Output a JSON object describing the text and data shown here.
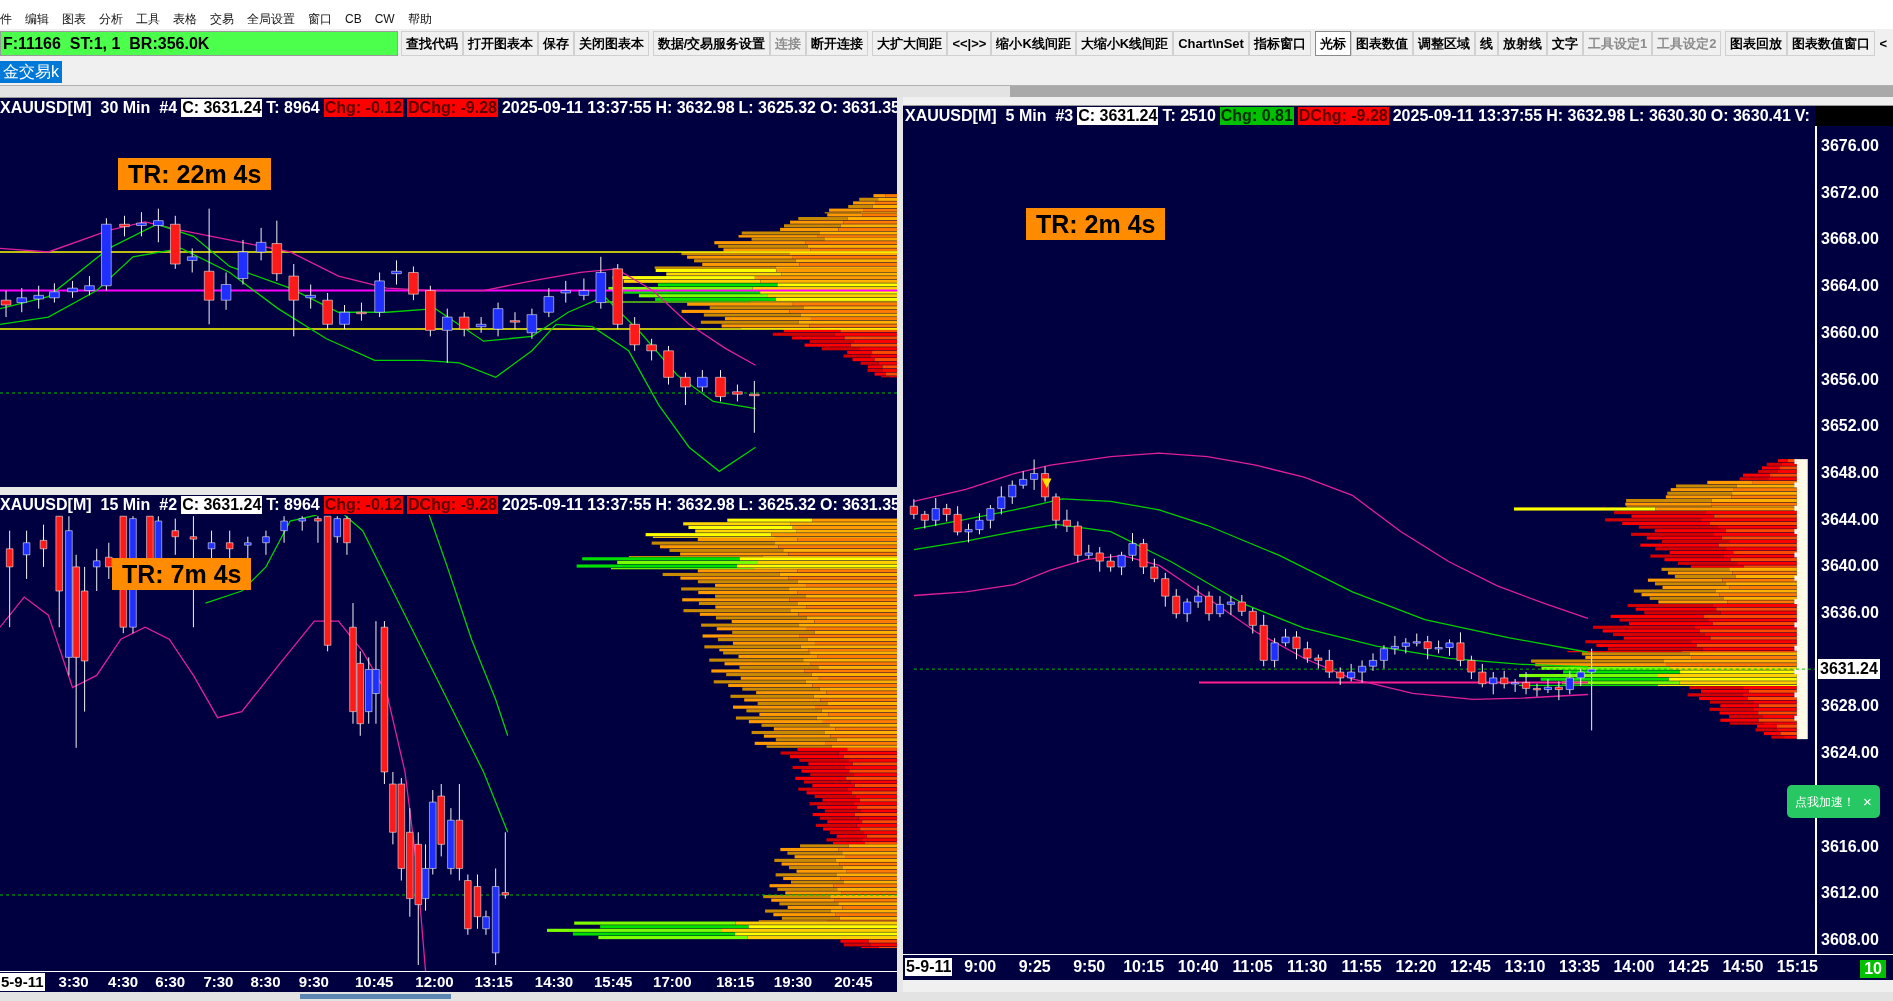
{
  "menu": [
    "件",
    "编辑",
    "图表",
    "分析",
    "工具",
    "表格",
    "交易",
    "全局设置",
    "窗口",
    "CB",
    "CW",
    "帮助"
  ],
  "toolbar": {
    "status": "F:11166  ST:1, 1  BR:356.0K",
    "button_groups": [
      [
        {
          "label": "查找代码",
          "disabled": false,
          "selected": false
        },
        {
          "label": "打开图表本",
          "disabled": false,
          "selected": false
        },
        {
          "label": "保存",
          "disabled": false,
          "selected": false
        },
        {
          "label": "关闭图表本",
          "disabled": false,
          "selected": false
        }
      ],
      [
        {
          "label": "数据/交易服务设置",
          "disabled": false,
          "selected": false
        },
        {
          "label": "连接",
          "disabled": true,
          "selected": false
        },
        {
          "label": "断开连接",
          "disabled": false,
          "selected": false
        }
      ],
      [
        {
          "label": "大扩大间距",
          "disabled": false,
          "selected": false
        },
        {
          "label": "<<|>>",
          "disabled": false,
          "selected": false
        },
        {
          "label": "缩小K线间距",
          "disabled": false,
          "selected": false
        },
        {
          "label": "大缩小K线间距",
          "disabled": false,
          "selected": false
        },
        {
          "label": "Chart\\nSet",
          "disabled": false,
          "selected": false
        },
        {
          "label": "指标窗口",
          "disabled": false,
          "selected": false
        }
      ],
      [
        {
          "label": "光标",
          "disabled": false,
          "selected": true
        },
        {
          "label": "图表数值",
          "disabled": false,
          "selected": false
        },
        {
          "label": "调整区域",
          "disabled": false,
          "selected": false
        },
        {
          "label": "线",
          "disabled": false,
          "selected": false
        },
        {
          "label": "放射线",
          "disabled": false,
          "selected": false
        },
        {
          "label": "文字",
          "disabled": false,
          "selected": false
        },
        {
          "label": "工具设定1",
          "disabled": true,
          "selected": false
        },
        {
          "label": "工具设定2",
          "disabled": true,
          "selected": false
        }
      ],
      [
        {
          "label": "图表回放",
          "disabled": false,
          "selected": false
        },
        {
          "label": "图表数值窗口",
          "disabled": false,
          "selected": false
        }
      ]
    ],
    "scroll_button": "<"
  },
  "tabs": [
    {
      "label": "金交易k",
      "selected": true
    }
  ],
  "left_charts": [
    {
      "header": {
        "symbol": "XAUUSD[M]",
        "interval": "30 Min",
        "chart_number": "#4",
        "close": "C: 3631.24",
        "trades": "T: 8964",
        "change": "Chg: -0.12",
        "change_positive": false,
        "daily_change": "DChg: -9.28",
        "daily_change_positive": false,
        "datetime": "2025-09-11 13:37:55",
        "high": "H: 3632.98",
        "low": "L: 3625.32",
        "open": "O: 3631.35"
      },
      "timer_label": "TR: 22m 4s"
    },
    {
      "header": {
        "symbol": "XAUUSD[M]",
        "interval": "15 Min",
        "chart_number": "#2",
        "close": "C: 3631.24",
        "trades": "T: 8964",
        "change": "Chg: -0.12",
        "change_positive": false,
        "daily_change": "DChg: -9.28",
        "daily_change_positive": false,
        "datetime": "2025-09-11 13:37:55",
        "high": "H: 3632.98",
        "low": "L: 3625.32",
        "open": "O: 3631.35"
      },
      "timer_label": "TR: 7m 4s",
      "x_axis_labels": [
        {
          "text": "5-9-11",
          "kind": "date"
        },
        {
          "text": "3:30",
          "kind": "time"
        },
        {
          "text": "4:30",
          "kind": "time"
        },
        {
          "text": "6:30",
          "kind": "time"
        },
        {
          "text": "7:30",
          "kind": "time"
        },
        {
          "text": "8:30",
          "kind": "time"
        },
        {
          "text": "9:30",
          "kind": "time"
        },
        {
          "text": "10:45",
          "kind": "time"
        },
        {
          "text": "12:00",
          "kind": "time"
        },
        {
          "text": "13:15",
          "kind": "time"
        },
        {
          "text": "14:30",
          "kind": "time"
        },
        {
          "text": "15:45",
          "kind": "time"
        },
        {
          "text": "17:00",
          "kind": "time"
        },
        {
          "text": "18:15",
          "kind": "time"
        },
        {
          "text": "19:30",
          "kind": "time"
        },
        {
          "text": "20:45",
          "kind": "time"
        }
      ]
    }
  ],
  "right_chart": {
    "header": {
      "symbol": "XAUUSD[M]",
      "interval": "5 Min",
      "chart_number": "#3",
      "close": "C: 3631.24",
      "trades": "T: 2510",
      "change": "Chg: 0.81",
      "change_positive": true,
      "daily_change": "DChg: -9.28",
      "daily_change_positive": false,
      "datetime": "2025-09-11 13:37:55",
      "high": "H: 3632.98",
      "low": "L: 3630.30",
      "open": "O: 3630.41",
      "volume": "V:"
    },
    "timer_label": "TR: 2m 4s",
    "y_axis_labels": [
      "3676.00",
      "3672.00",
      "3668.00",
      "3664.00",
      "3660.00",
      "3656.00",
      "3652.00",
      "3648.00",
      "3644.00",
      "3640.00",
      "3636.00",
      "3628.00",
      "3624.00",
      "3616.00",
      "3612.00",
      "3608.00"
    ],
    "price_label": "3631.24",
    "x_axis_labels": [
      {
        "text": "5-9-11",
        "kind": "date"
      },
      {
        "text": "9:00",
        "kind": "time"
      },
      {
        "text": "9:25",
        "kind": "time"
      },
      {
        "text": "9:50",
        "kind": "time"
      },
      {
        "text": "10:15",
        "kind": "time"
      },
      {
        "text": "10:40",
        "kind": "time"
      },
      {
        "text": "11:05",
        "kind": "time"
      },
      {
        "text": "11:30",
        "kind": "time"
      },
      {
        "text": "11:55",
        "kind": "time"
      },
      {
        "text": "12:20",
        "kind": "time"
      },
      {
        "text": "12:45",
        "kind": "time"
      },
      {
        "text": "13:10",
        "kind": "time"
      },
      {
        "text": "13:35",
        "kind": "time"
      },
      {
        "text": "14:00",
        "kind": "time"
      },
      {
        "text": "14:25",
        "kind": "time"
      },
      {
        "text": "14:50",
        "kind": "time"
      },
      {
        "text": "15:15",
        "kind": "time"
      }
    ],
    "bar_count": "10"
  },
  "popup": {
    "message": "点我加速！",
    "close": "×"
  }
}
